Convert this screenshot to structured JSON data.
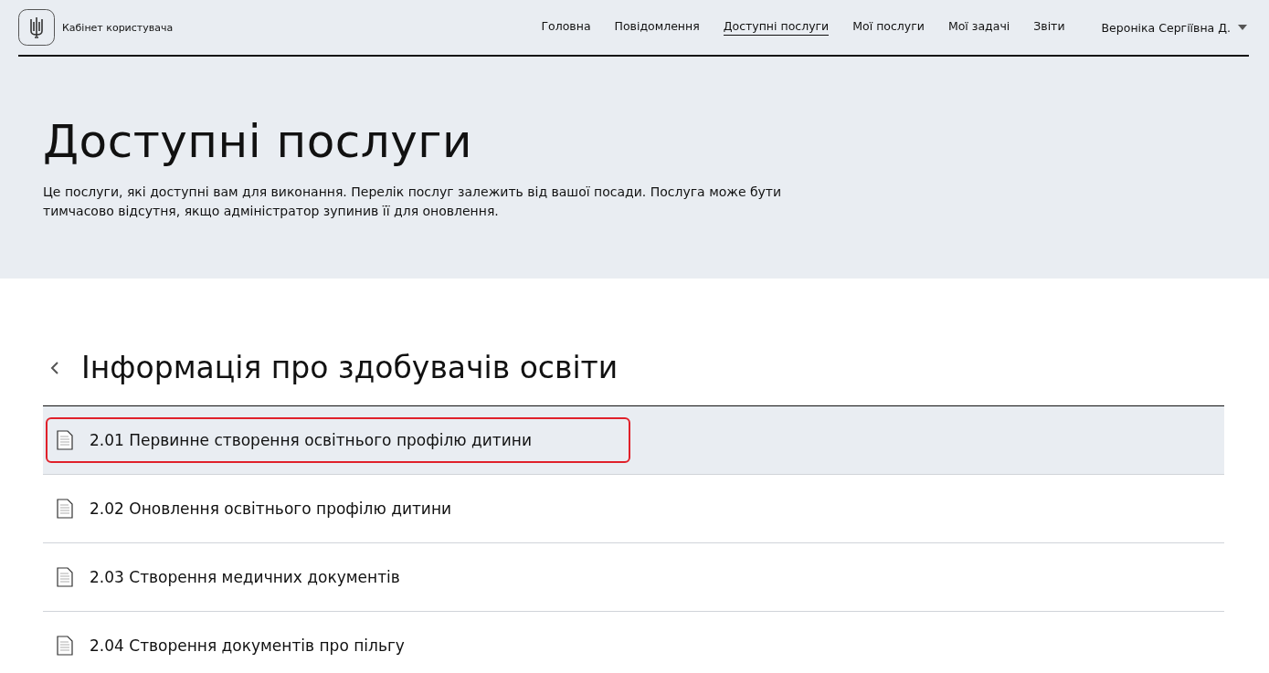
{
  "header": {
    "logo_text": "Кабінет користувача",
    "nav": [
      {
        "label": "Головна",
        "selected": false
      },
      {
        "label": "Повідомлення",
        "selected": false
      },
      {
        "label": "Доступні послуги",
        "selected": true
      },
      {
        "label": "Мої послуги",
        "selected": false
      },
      {
        "label": "Мої задачі",
        "selected": false
      },
      {
        "label": "Звіти",
        "selected": false
      }
    ],
    "user": "Вероніка Сергіївна Д."
  },
  "hero": {
    "title": "Доступні послуги",
    "description": "Це послуги, які доступні вам для виконання. Перелік послуг залежить від вашої посади. Послуга може бути тимчасово відсутня, якщо адміністратор зупинив її для оновлення."
  },
  "section": {
    "title": "Інформація про здобувачів освіти",
    "services": [
      {
        "label": "2.01 Первинне створення освітнього профілю дитини",
        "selected": true,
        "highlighted": true
      },
      {
        "label": "2.02 Оновлення освітнього профілю дитини",
        "selected": false,
        "highlighted": false
      },
      {
        "label": "2.03 Створення медичних документів",
        "selected": false,
        "highlighted": false
      },
      {
        "label": "2.04 Створення документів про пільгу",
        "selected": false,
        "highlighted": false
      }
    ]
  }
}
